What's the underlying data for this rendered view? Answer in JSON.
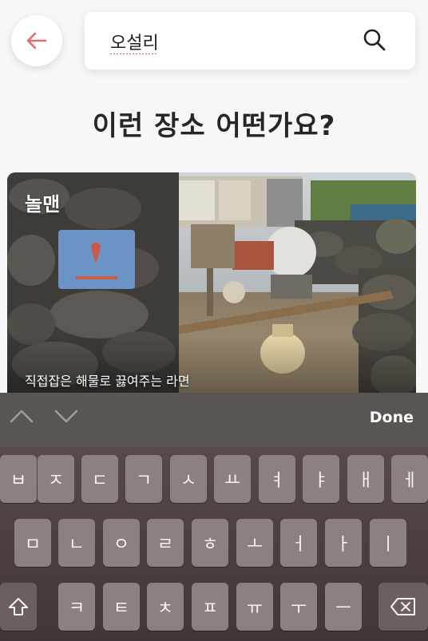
{
  "search": {
    "value": "오설리",
    "back_icon": "arrow-left-icon",
    "search_icon": "search-icon",
    "accent_color": "#e46a6a"
  },
  "main": {
    "heading": "이런 장소 어떤가요?"
  },
  "card": {
    "title": "놀맨",
    "description": "직접잡은 해물로 끓여주는 라면"
  },
  "keyboard_toolbar": {
    "up_icon": "chevron-up-icon",
    "down_icon": "chevron-down-icon",
    "done_label": "Done"
  },
  "keyboard": {
    "row1": [
      "ㅂ",
      "ㅈ",
      "ㄷ",
      "ㄱ",
      "ㅅ",
      "ㅛ",
      "ㅕ",
      "ㅑ",
      "ㅐ",
      "ㅔ"
    ],
    "row2": [
      "ㅁ",
      "ㄴ",
      "ㅇ",
      "ㄹ",
      "ㅎ",
      "ㅗ",
      "ㅓ",
      "ㅏ",
      "ㅣ"
    ],
    "row3": [
      "ㅋ",
      "ㅌ",
      "ㅊ",
      "ㅍ",
      "ㅠ",
      "ㅜ",
      "ㅡ"
    ],
    "shift_icon": "shift-icon",
    "backspace_icon": "backspace-icon"
  }
}
